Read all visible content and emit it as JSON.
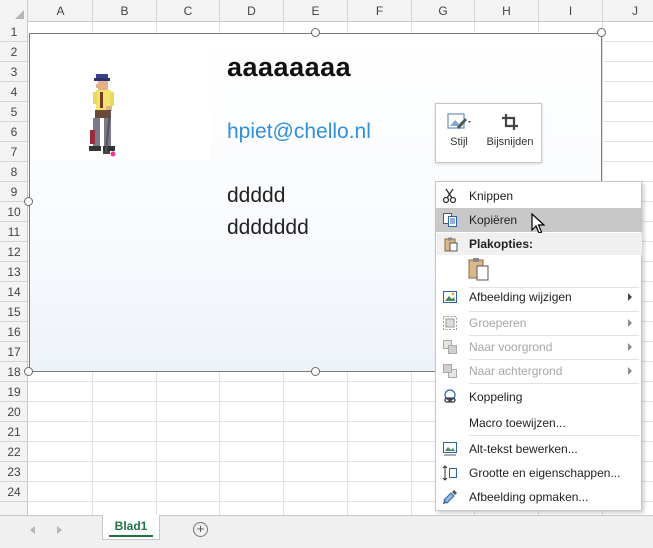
{
  "columns": [
    "A",
    "B",
    "C",
    "D",
    "E",
    "F",
    "G",
    "H",
    "I",
    "J"
  ],
  "rows": [
    "1",
    "2",
    "3",
    "4",
    "5",
    "6",
    "7",
    "8",
    "9",
    "10",
    "11",
    "12",
    "13",
    "14",
    "15",
    "16",
    "17",
    "18",
    "19",
    "20",
    "21",
    "22",
    "23",
    "24"
  ],
  "picture": {
    "title": "aaaaaaaa",
    "email": "hpiet@chello.nl",
    "line1": "ddddd",
    "line2": "ddddddd"
  },
  "mini_toolbar": {
    "style_label": "Stijl",
    "crop_label": "Bijsnijden"
  },
  "context_menu": {
    "cut": "Knippen",
    "copy": "Kopiëren",
    "paste_options_header": "Plakopties:",
    "change_picture": "Afbeelding wijzigen",
    "group": "Groeperen",
    "bring_forward": "Naar voorgrond",
    "send_backward": "Naar achtergrond",
    "link": "Koppeling",
    "assign_macro": "Macro toewijzen...",
    "edit_alt_text": "Alt-tekst bewerken...",
    "size_properties": "Grootte en eigenschappen...",
    "format_picture": "Afbeelding opmaken..."
  },
  "sheet_tabs": {
    "active_tab": "Blad1",
    "add_sheet_symbol": "+"
  },
  "colors": {
    "accent_green": "#217346",
    "email_blue": "#2f8fd8",
    "menu_hover": "#c8c8c8"
  }
}
